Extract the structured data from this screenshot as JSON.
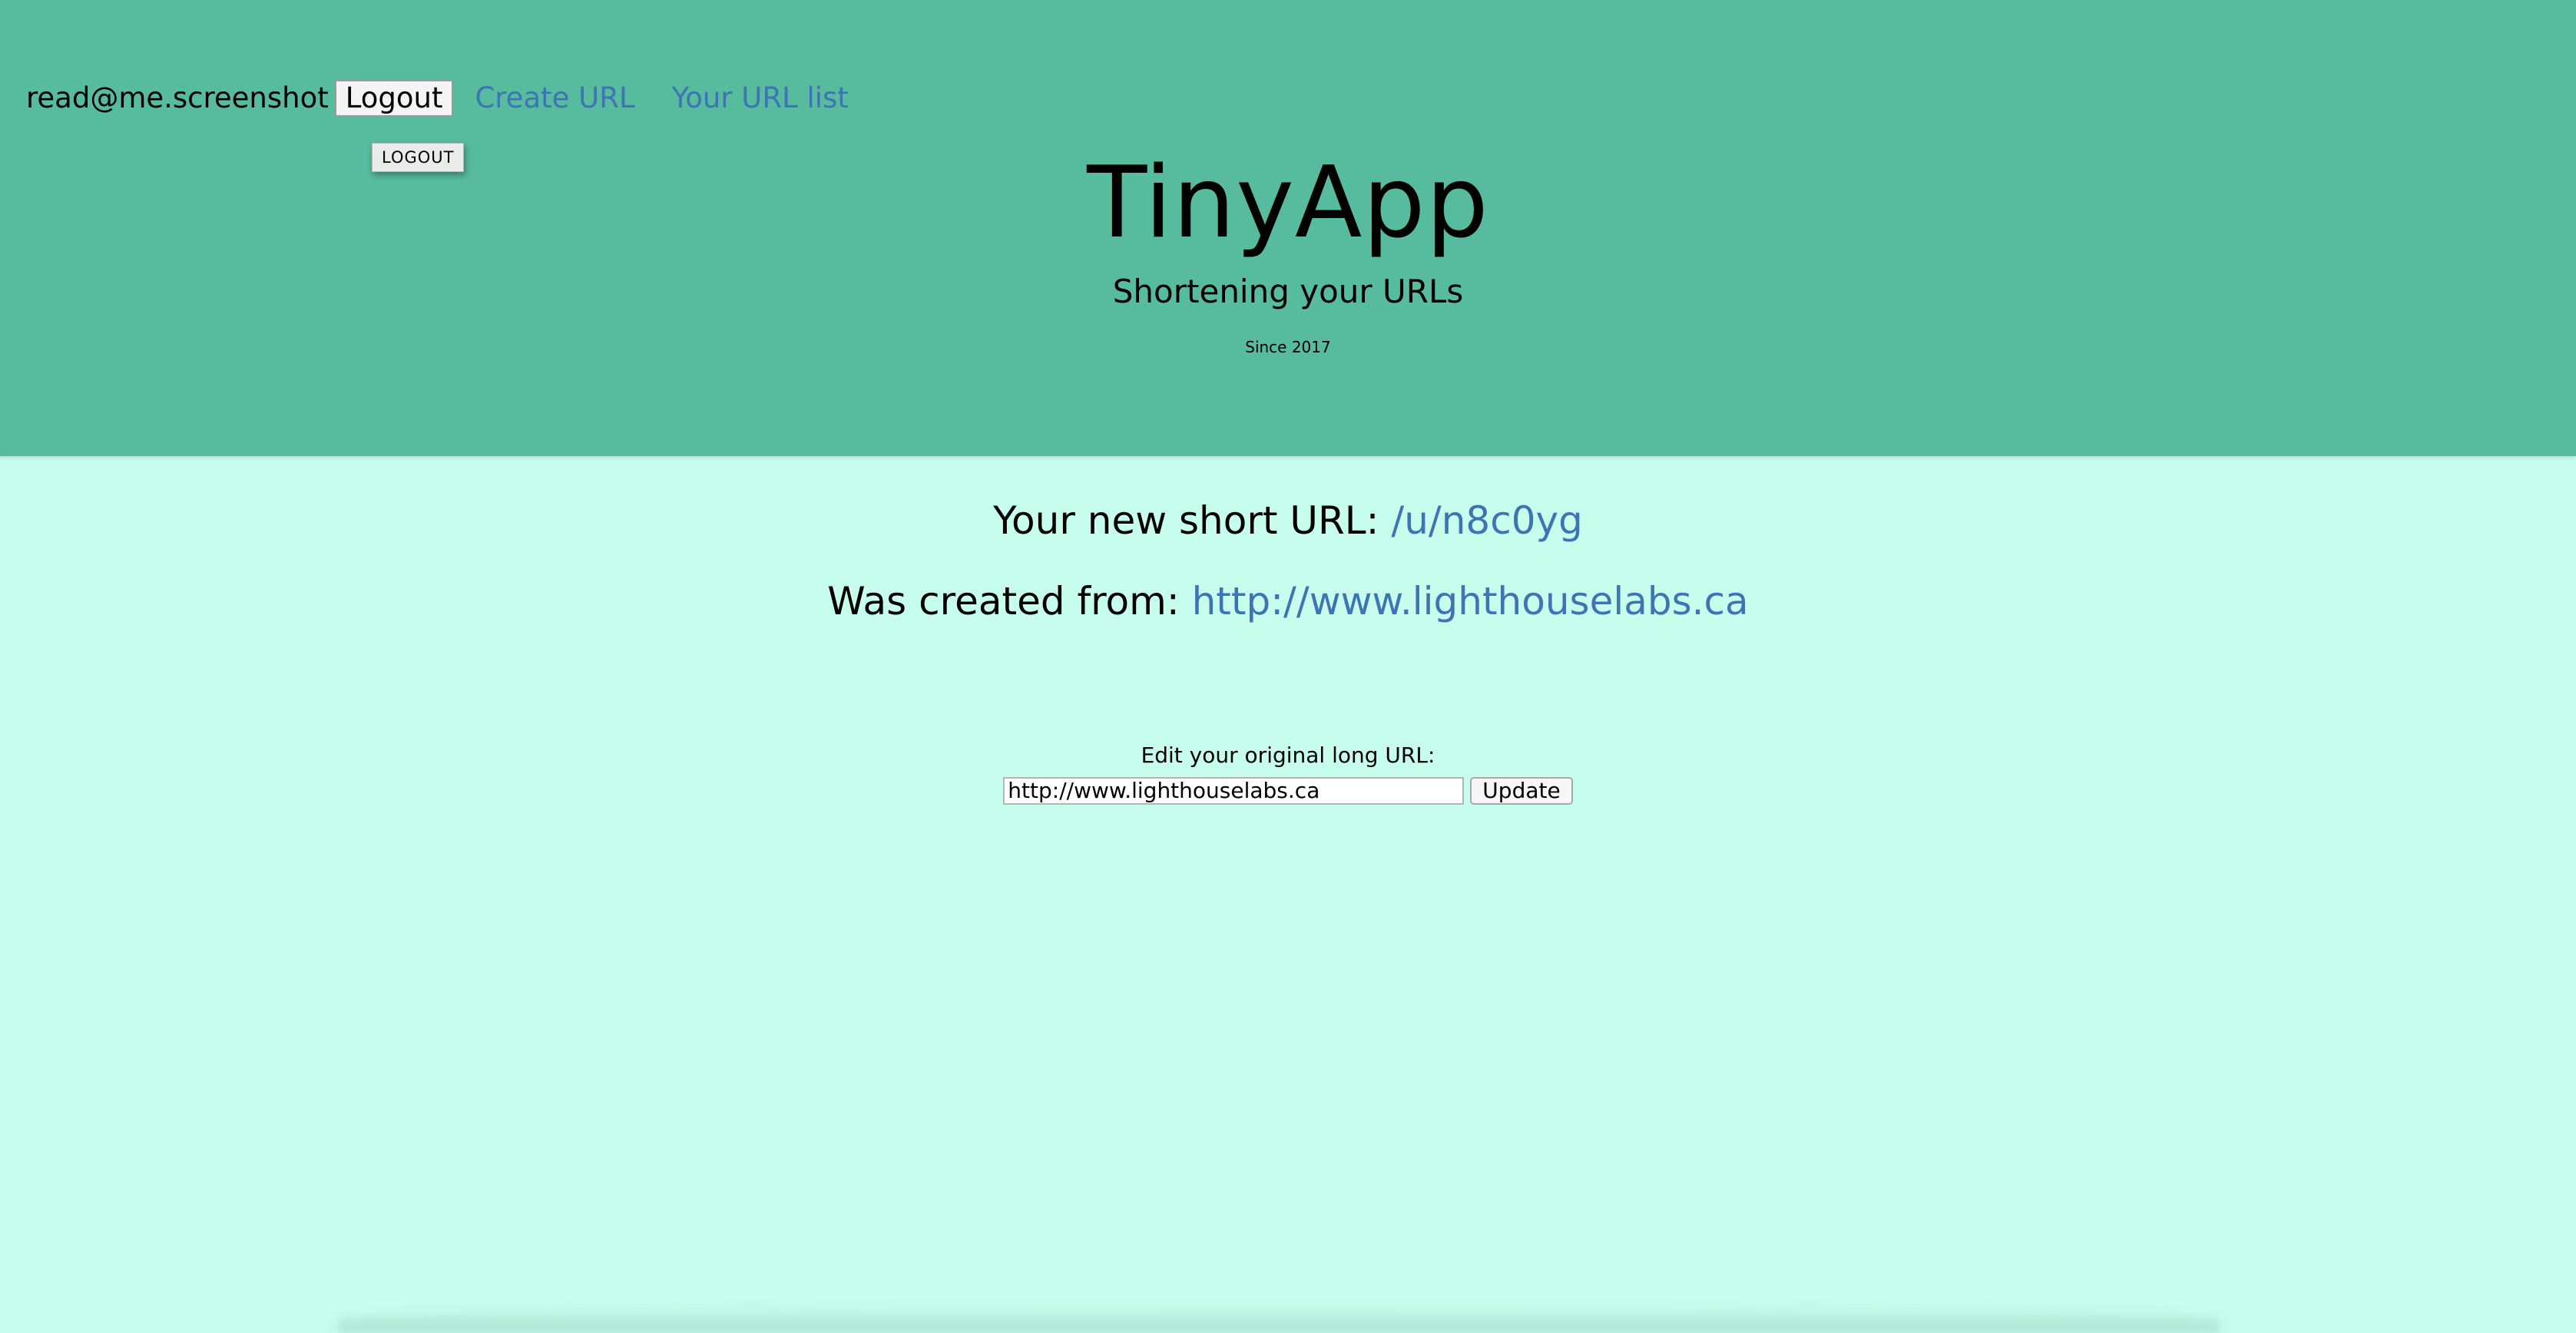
{
  "nav": {
    "user_email": "read@me.screenshot",
    "logout_label": "Logout",
    "create_url_label": "Create URL",
    "url_list_label": "Your URL list",
    "tooltip_text": "LOGOUT"
  },
  "brand": {
    "title": "TinyApp",
    "tagline": "Shortening your URLs",
    "since": "Since 2017"
  },
  "result": {
    "short_prefix": "Your new short URL: ",
    "short_url": "/u/n8c0yg",
    "origin_prefix": "Was created from: ",
    "long_url": "http://www.lighthouselabs.ca"
  },
  "edit": {
    "label": "Edit your original long URL:",
    "input_value": "http://www.lighthouselabs.ca",
    "update_label": "Update"
  },
  "colors": {
    "header_bg": "#57bb9e",
    "page_bg": "#c6fdec",
    "link": "#3e74b4"
  }
}
